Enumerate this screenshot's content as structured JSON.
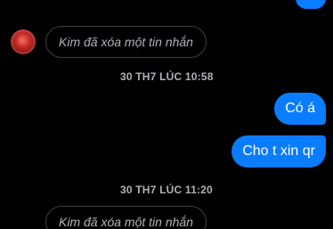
{
  "messages": {
    "deleted_1": "Kim đã xóa một tin nhắn",
    "timestamp_1": "30 TH7 LÚC 10:58",
    "outgoing_1": "Có á",
    "outgoing_2": "Cho t xin qr",
    "timestamp_2": "30 TH7 LÚC 11:20",
    "deleted_2": "Kim đã xóa một tin nhắn"
  },
  "colors": {
    "background": "#000000",
    "outgoing_bubble": "#0a7cff",
    "secondary_text": "#b0b3b8",
    "deleted_border": "#3e4042"
  },
  "icons": {
    "contact_avatar": "avatar-red-profile-photo"
  }
}
